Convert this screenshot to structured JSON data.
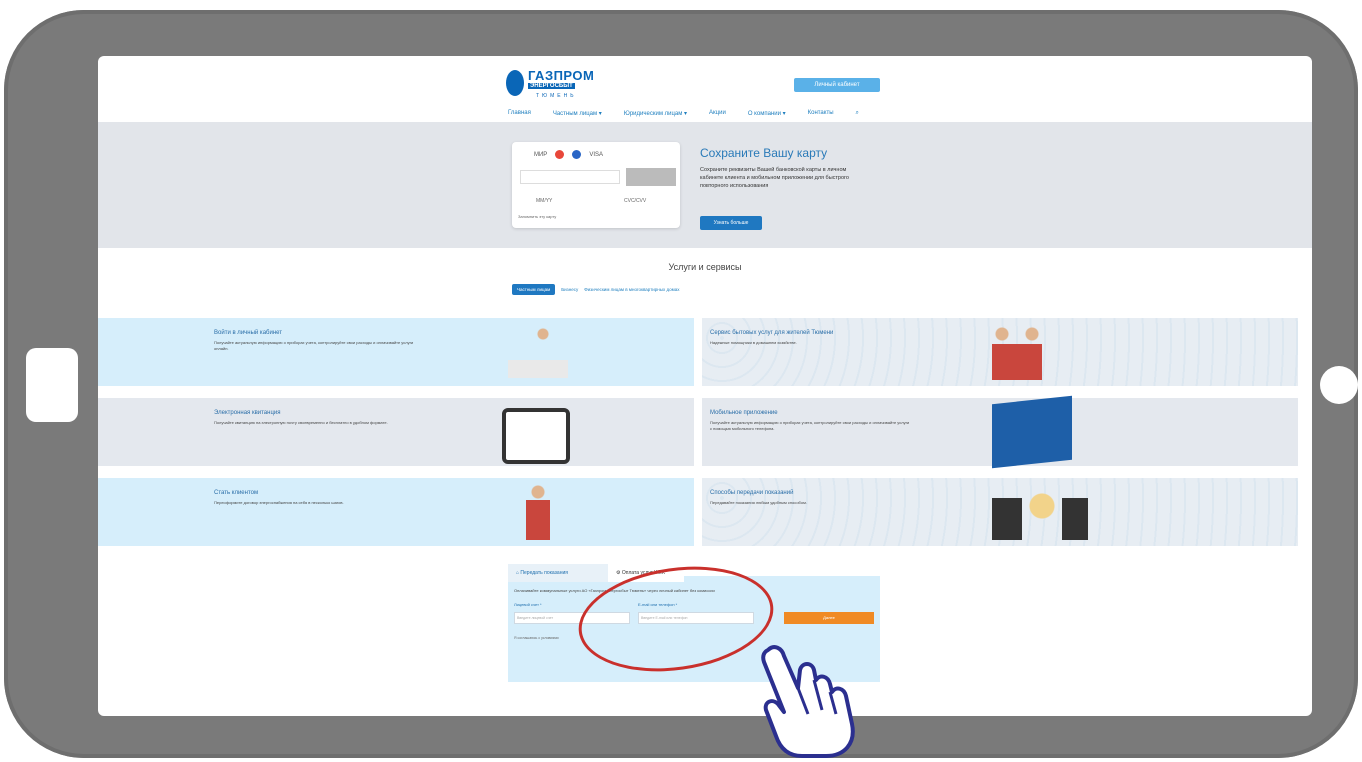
{
  "header": {
    "logo_text": "ГАЗПРОМ",
    "logo_sub": "ЭНЕРГОСБЫТ",
    "logo_city": "ТЮМЕНЬ",
    "cabinet_button": "Личный кабинет",
    "nav": [
      "Главная",
      "Частным лицам ▾",
      "Юридическим лицам ▾",
      "Акции",
      "О компании ▾",
      "Контакты"
    ]
  },
  "banner": {
    "card_logos": [
      "МИР",
      "VISA"
    ],
    "card_mmyy": "MM/YY",
    "card_cvc": "CVC/CVV",
    "card_save": "Запомнить эту карту",
    "title": "Сохраните Вашу карту",
    "text": "Сохраните реквизиты Вашей банковской карты в личном кабинете клиента и мобильном приложении для быстрого повторного использования",
    "button": "Узнать больше"
  },
  "services": {
    "title": "Услуги и сервисы",
    "tabs": [
      "Частным лицам",
      "Бизнесу",
      "Физическим лицам в многоквартирных домах"
    ],
    "tiles": [
      {
        "title": "Войти в личный кабинет",
        "desc": "Получайте актуальную информацию о приборах учета, контролируйте свои расходы и оплачивайте услуги онлайн."
      },
      {
        "title": "Сервис бытовых услуг для жителей Тюмени",
        "desc": "Надежные помощники в домашнем хозяйстве."
      },
      {
        "title": "Электронная квитанция",
        "desc": "Получайте квитанцию на электронную почту своевременно и бесплатно в удобном формате."
      },
      {
        "title": "Мобильное приложение",
        "desc": "Получайте актуальную информацию о приборах учета, контролируйте свои расходы и оплачивайте услуги с помощью мобильного телефона."
      },
      {
        "title": "Стать клиентом",
        "desc": "Переоформите договор энергоснабжения на себя в несколько шагов."
      },
      {
        "title": "Способы передачи показаний",
        "desc": "Передавайте показания любым удобным способом."
      }
    ]
  },
  "form": {
    "tab1": "Передать показания",
    "tab2": "Оплата услуг ЖКХ",
    "desc": "Оплачивайте коммунальные услуги АО «Газпром энергосбыт Тюмень» через личный кабинет без комиссии",
    "label_account": "Лицевой счет *",
    "label_contact": "E-mail или телефон *",
    "placeholder_account": "Введите лицевой счет",
    "placeholder_contact": "Введите E-mail или телефон",
    "go_button": "Далее",
    "link": "Я соглашаюсь с условиями"
  }
}
